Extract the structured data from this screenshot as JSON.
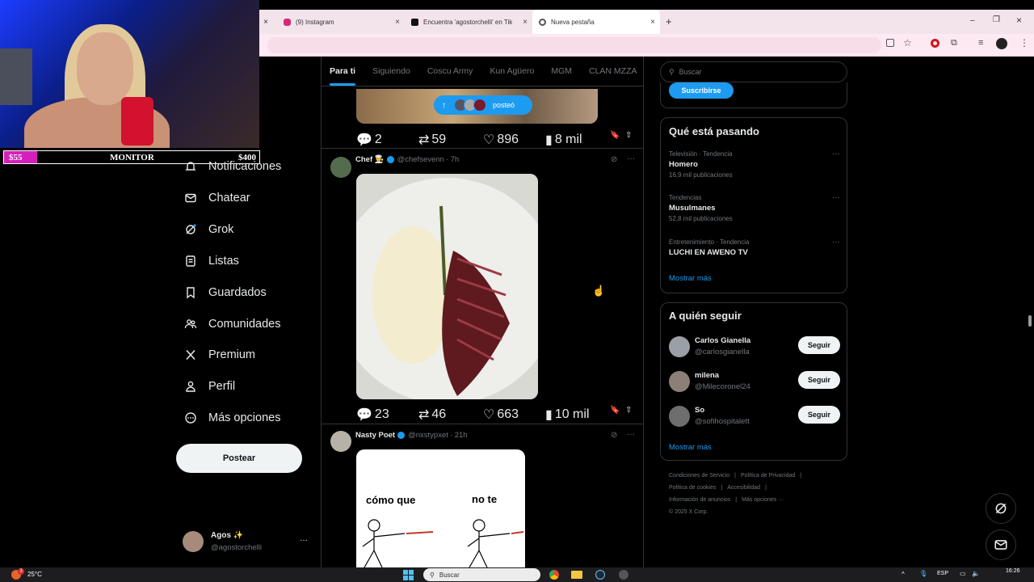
{
  "browser": {
    "tabs": [
      {
        "title": "(9) Instagram",
        "active": false
      },
      {
        "title": "Encuentra 'agostorchelli' en Tik",
        "active": false
      },
      {
        "title": "Nueva pestaña",
        "active": true
      }
    ],
    "new_tab_glyph": "+",
    "close_glyph": "×"
  },
  "stream": {
    "monitor": {
      "left": "$55",
      "center": "MONITOR",
      "right": "$400",
      "progress": 0.13
    },
    "colors": {
      "bar_fill": "#d61fb9"
    }
  },
  "nav": {
    "items": [
      {
        "label": "Notificaciones",
        "icon": "bell-icon"
      },
      {
        "label": "Chatear",
        "icon": "mail-icon"
      },
      {
        "label": "Grok",
        "icon": "grok-icon"
      },
      {
        "label": "Listas",
        "icon": "list-icon"
      },
      {
        "label": "Guardados",
        "icon": "bookmark-icon"
      },
      {
        "label": "Comunidades",
        "icon": "people-icon"
      },
      {
        "label": "Premium",
        "icon": "x-logo-icon"
      },
      {
        "label": "Perfil",
        "icon": "person-icon"
      },
      {
        "label": "Más opciones",
        "icon": "more-circle-icon"
      }
    ],
    "post_button": "Postear",
    "account": {
      "name": "Agos ✨",
      "handle": "@agostorchelli",
      "menu": "···"
    }
  },
  "feed": {
    "tabs": [
      "Para ti",
      "Siguiendo",
      "Coscu Army",
      "Kun Agüero",
      "MGM",
      "CLAN MZZA"
    ],
    "active_tab": "Para ti",
    "new_posts_pill": {
      "label": "posteó"
    },
    "post0_metrics": {
      "replies": "2",
      "reposts": "59",
      "likes": "896",
      "views": "8 mil"
    },
    "post1": {
      "name": "Chef 👨‍🍳",
      "handle": "@chefsevenn",
      "time": "· 7h",
      "metrics": {
        "replies": "23",
        "reposts": "46",
        "likes": "663",
        "views": "10 mil"
      }
    },
    "post2": {
      "name": "Nasty Poet",
      "handle": "@nxstypxet",
      "time": "· 21h",
      "meme_left": "cómo que",
      "meme_right": "no te"
    },
    "colors": {
      "accent": "#1d9bf0"
    }
  },
  "sidebar": {
    "search_placeholder": "Buscar",
    "subscribe_button": "Suscribirse",
    "trends_title": "Qué está pasando",
    "trends": [
      {
        "meta": "Televisión · Tendencia",
        "name": "Homero",
        "count": "16,9 mil publicaciones"
      },
      {
        "meta": "Tendencias",
        "name": "Musulmanes",
        "count": "52,8 mil publicaciones"
      },
      {
        "meta": "Entretenimiento · Tendencia",
        "name": "LUCHI EN AWENO TV",
        "count": ""
      }
    ],
    "show_more": "Mostrar más",
    "follow_title": "A quién seguir",
    "follow": [
      {
        "name": "Carlos Gianella",
        "handle": "@carlosgianella",
        "button": "Seguir"
      },
      {
        "name": "milena",
        "handle": "@Milecoronel24",
        "button": "Seguir"
      },
      {
        "name": "So",
        "handle": "@sofihospitalett",
        "button": "Seguir"
      }
    ],
    "footer_lines": [
      [
        "Condiciones de Servicio",
        "Política de Privacidad"
      ],
      [
        "Política de cookies",
        "Accesibilidad"
      ],
      [
        "Información de anuncios",
        "Más opciones ···"
      ],
      [
        "© 2025 X Corp."
      ]
    ]
  },
  "taskbar": {
    "weather": "25°C",
    "search": "Buscar",
    "lang": "ESP",
    "time": "16:26",
    "badge": "3"
  }
}
